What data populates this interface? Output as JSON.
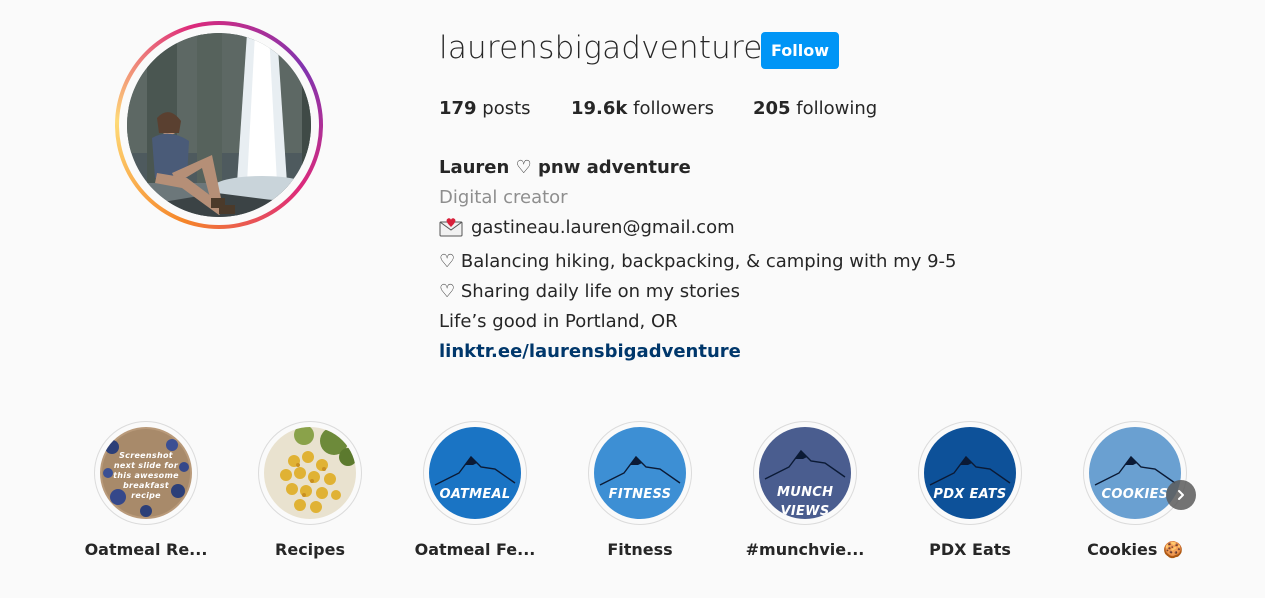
{
  "profile": {
    "username": "laurensbigadventure",
    "follow_label": "Follow",
    "posts_count": "179",
    "posts_label": " posts",
    "followers_count": "19.6k",
    "followers_label": " followers",
    "following_count": "205",
    "following_label": " following"
  },
  "bio": {
    "name": "Lauren ♡ pnw adventure",
    "category": "Digital creator",
    "email": "gastineau.lauren@gmail.com",
    "line1": "♡ Balancing hiking, backpacking, & camping with my 9-5",
    "line2": "♡ Sharing daily life on my stories",
    "line3": "Life’s good in Portland, OR",
    "link": "linktr.ee/laurensbigadventure"
  },
  "highlights": [
    {
      "label": "Oatmeal Re...",
      "cover_text": "Screenshot next slide for this awesome breakfast recipe",
      "icon": "oatmeal-photo"
    },
    {
      "label": "Recipes",
      "icon": "food-photo"
    },
    {
      "label": "Oatmeal Fe...",
      "cover_text": "OATMEAL",
      "color": "#1a74c4",
      "icon": "mountain-icon"
    },
    {
      "label": "Fitness",
      "cover_text": "FITNESS",
      "color": "#3d8fd4",
      "icon": "mountain-icon"
    },
    {
      "label": "#munchvie...",
      "cover_text": "MUNCH VIEWS",
      "color": "#4a5d8f",
      "icon": "mountain-icon"
    },
    {
      "label": "PDX Eats",
      "cover_text": "PDX EATS",
      "color": "#0d5199",
      "icon": "mountain-icon"
    },
    {
      "label": "Cookies 🍪",
      "cover_text": "COOKIES",
      "color": "#6aa0d1",
      "icon": "mountain-icon"
    }
  ],
  "colors": {
    "follow_button": "#0095f6",
    "link": "#00376b",
    "muted": "#8e8e8e"
  }
}
